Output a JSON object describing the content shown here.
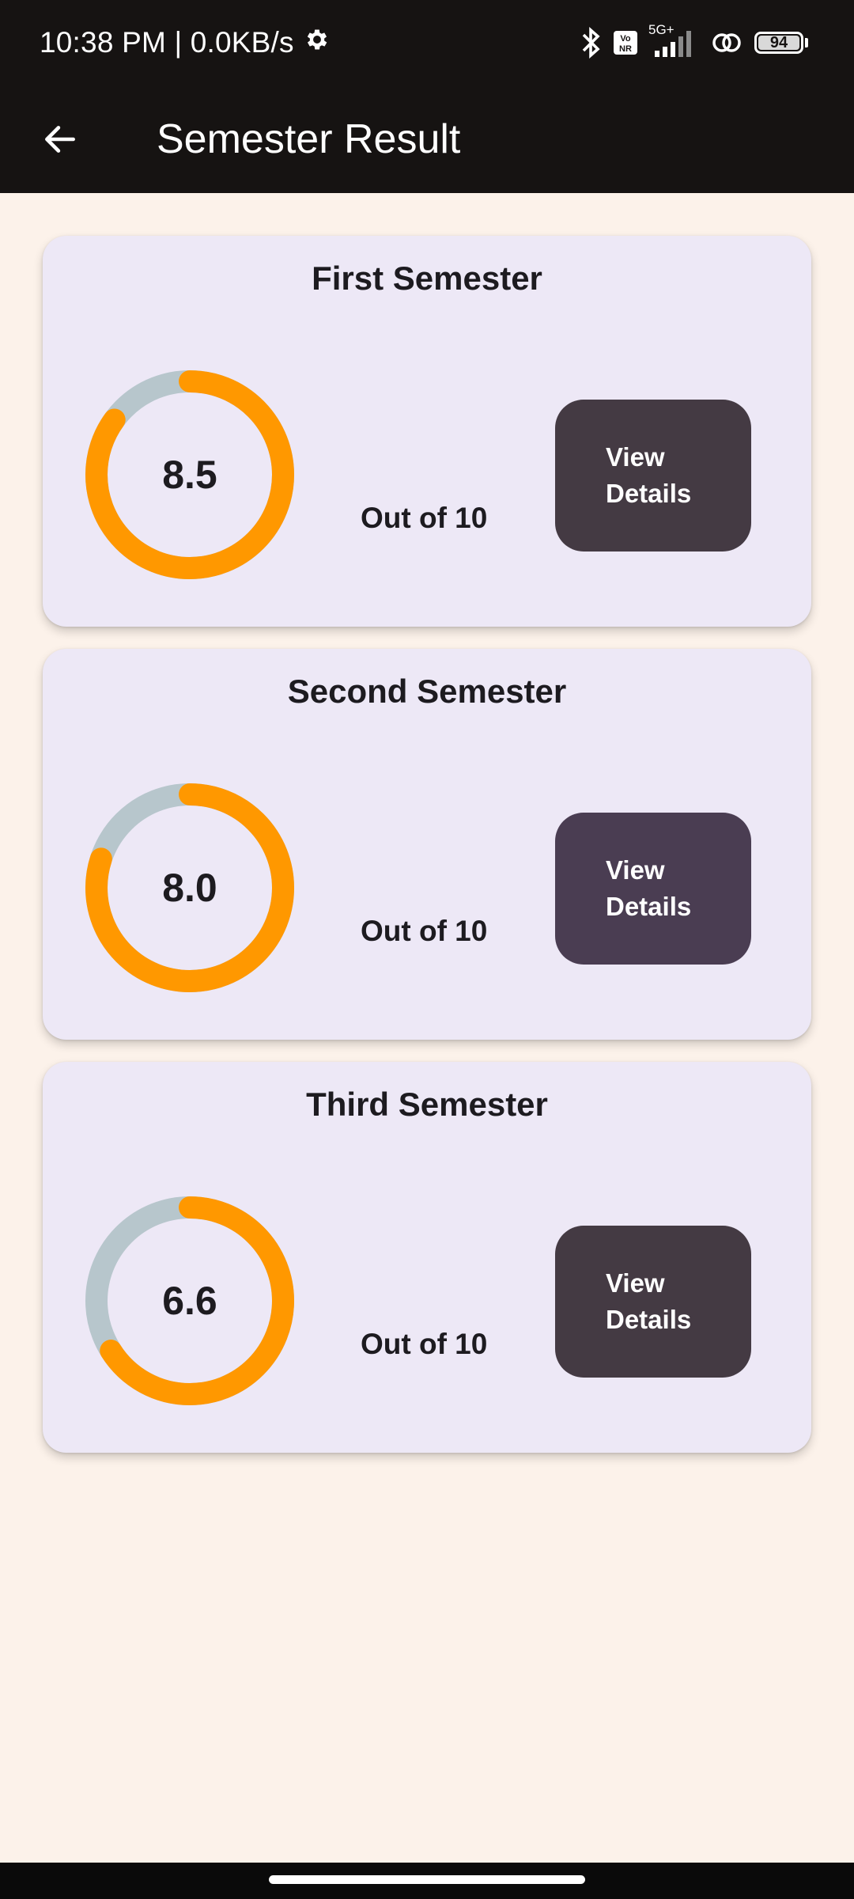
{
  "status_bar": {
    "time_speed": "10:38 PM | 0.0KB/s",
    "network": "5G+",
    "volte": "VoNR",
    "battery": "94"
  },
  "app_bar": {
    "title": "Semester Result"
  },
  "colors": {
    "progress": "#ff9800",
    "track": "#b7c6cc",
    "card_background": "#ede8f6",
    "button_dark": "#443a43",
    "button_purple": "#4a3d52"
  },
  "semesters": [
    {
      "title": "First Semester",
      "score": "8.5",
      "score_value": 8.5,
      "max_label": "Out of 10",
      "max_value": 10,
      "button": "View Details"
    },
    {
      "title": "Second Semester",
      "score": "8.0",
      "score_value": 8.0,
      "max_label": "Out of 10",
      "max_value": 10,
      "button": "View Details"
    },
    {
      "title": "Third Semester",
      "score": "6.6",
      "score_value": 6.6,
      "max_label": "Out of 10",
      "max_value": 10,
      "button": "View Details"
    }
  ]
}
